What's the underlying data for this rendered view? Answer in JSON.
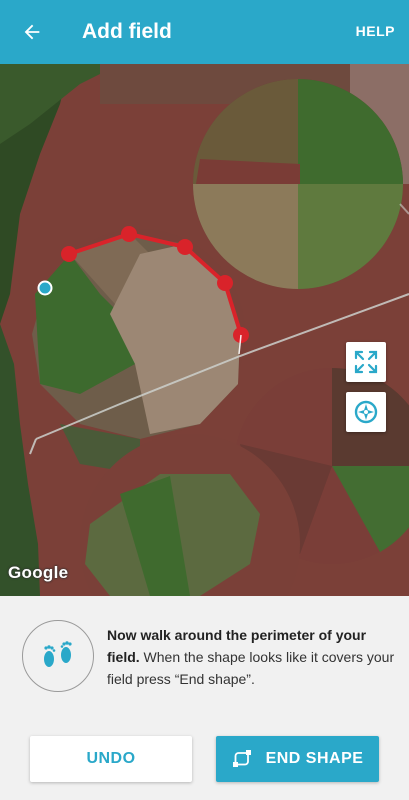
{
  "appbar": {
    "title": "Add field",
    "help_label": "HELP",
    "back_icon": "arrow-left-icon",
    "color": "#2aa8c9"
  },
  "map": {
    "attribution": "Google",
    "perimeter_color": "#d9232a",
    "expand_icon": "expand-icon",
    "locate_icon": "locate-icon"
  },
  "panel": {
    "feet_icon": "footsteps-icon",
    "message_bold": "Now walk around the perimeter of your field.",
    "message_rest": " When the shape looks like it covers your field press “End shape”.",
    "undo_label": "UNDO",
    "end_label": "END SHAPE",
    "end_icon": "draw-shape-icon"
  }
}
